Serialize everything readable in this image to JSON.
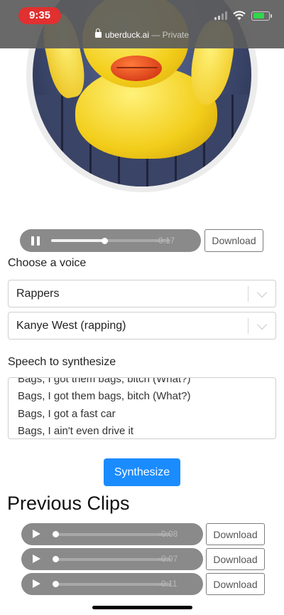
{
  "status_bar": {
    "time": "9:35"
  },
  "browser": {
    "domain": "uberduck.ai",
    "mode": "Private"
  },
  "hero": {
    "image_alt": "yellow rubber duck"
  },
  "main_player": {
    "state": "playing",
    "progress": 0.45,
    "remaining": "-0:17"
  },
  "download_label": "Download",
  "voice": {
    "label": "Choose a voice",
    "category": "Rappers",
    "name": "Kanye West (rapping)"
  },
  "speech": {
    "label": "Speech to synthesize",
    "lines": [
      "Bags, I got them bags, bitch (What?)",
      "Bags, I got them bags, bitch (What?)",
      "Bags, I got a fast car",
      "Bags, I ain't even drive it"
    ]
  },
  "synthesize_label": "Synthesize",
  "previous": {
    "heading": "Previous Clips",
    "clips": [
      {
        "remaining": "-0:08",
        "progress": 0.0
      },
      {
        "remaining": "-0:07",
        "progress": 0.0
      },
      {
        "remaining": "-0:11",
        "progress": 0.0
      }
    ]
  },
  "colors": {
    "accent": "#1a8cff",
    "player": "#8a8a8a",
    "time_pill": "#e0302f"
  }
}
